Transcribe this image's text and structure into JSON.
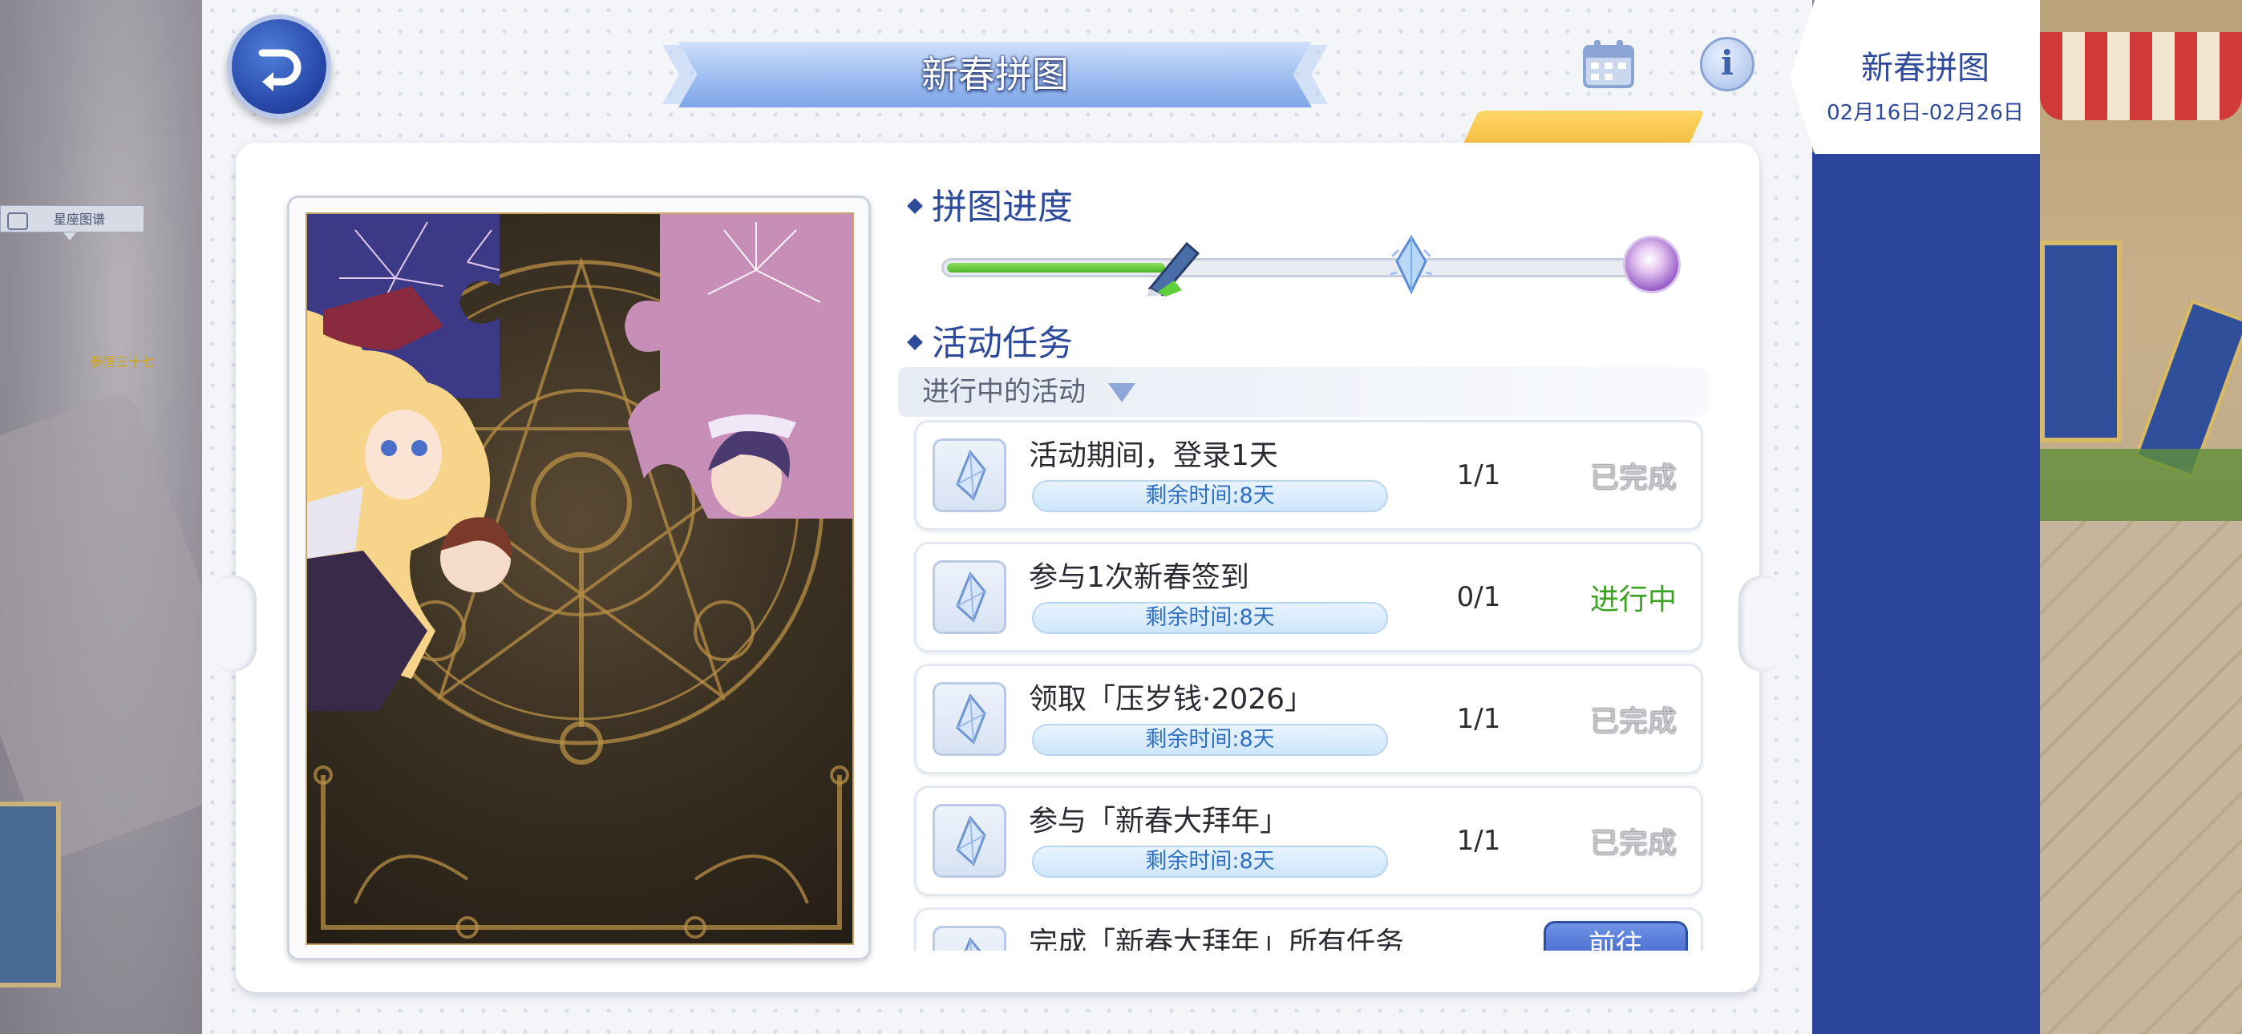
{
  "background": {
    "left_tag_label": "星座图谱",
    "left_gold_text": "参悟三十七"
  },
  "header": {
    "title": "新春拼图"
  },
  "event_tab": {
    "name": "新春拼图",
    "date_range": "02月16日-02月26日"
  },
  "progress": {
    "heading": "拼图进度",
    "fill_fraction": 0.3
  },
  "tasks": {
    "heading": "活动任务",
    "filter_label": "进行中的活动",
    "items": [
      {
        "name": "活动期间，登录1天",
        "time": "剩余时间:8天",
        "count": "1/1",
        "status": "已完成"
      },
      {
        "name": "参与1次新春签到",
        "time": "剩余时间:8天",
        "count": "0/1",
        "status": "进行中"
      },
      {
        "name": "领取「压岁钱·2026」",
        "time": "剩余时间:8天",
        "count": "1/1",
        "status": "已完成"
      },
      {
        "name": "参与「新春大拜年」",
        "time": "剩余时间:8天",
        "count": "1/1",
        "status": "已完成"
      },
      {
        "name": "完成「新春大拜年」所有任务",
        "time": "",
        "count": "",
        "status": "",
        "button": "前往"
      }
    ]
  },
  "colors": {
    "primary": "#2e4a9b",
    "in_progress": "#3aa321",
    "timer_text": "#2f6fc1",
    "event_strip": "#2b459c"
  },
  "icons": {
    "back": "back-arrow-icon",
    "calendar": "calendar-icon",
    "info": "info-icon",
    "task": "crystal-icon"
  }
}
